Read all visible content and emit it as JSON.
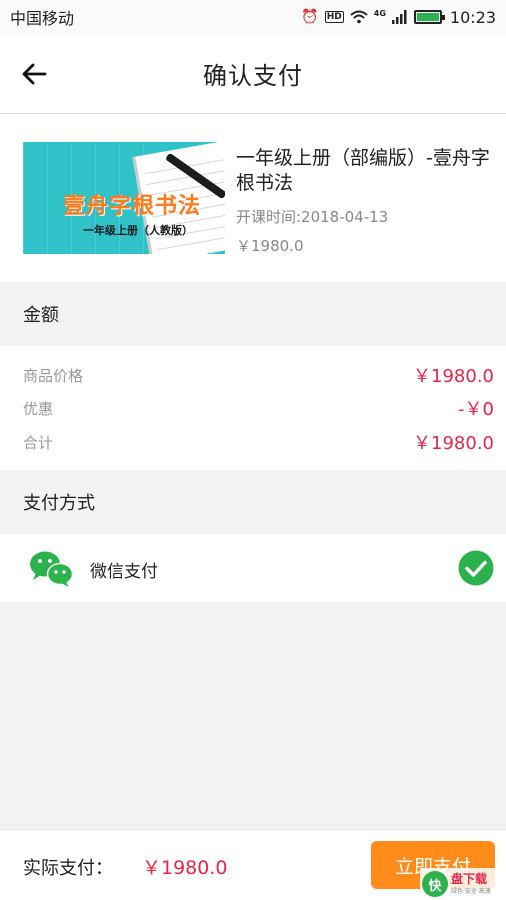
{
  "statusbar": {
    "carrier": "中国移动",
    "time": "10:23",
    "hd_label": "HD",
    "network_label": "4G"
  },
  "header": {
    "title": "确认支付"
  },
  "product": {
    "thumb_title": "壹舟字根书法",
    "thumb_subtitle": "一年级上册（人教版）",
    "title": "一年级上册（部编版）-壹舟字根书法",
    "date": "开课时间:2018-04-13",
    "price": "￥1980.0"
  },
  "amount_section": {
    "heading": "金额",
    "rows": [
      {
        "label": "商品价格",
        "value": "￥1980.0"
      },
      {
        "label": "优惠",
        "value": "-￥0"
      },
      {
        "label": "合计",
        "value": "￥1980.0"
      }
    ]
  },
  "payment_section": {
    "heading": "支付方式",
    "methods": [
      {
        "label": "微信支付",
        "icon": "wechat-icon",
        "selected": true
      }
    ]
  },
  "footer": {
    "actual_label": "实际支付：",
    "actual_value": "￥1980.0",
    "pay_button": "立即支付"
  },
  "watermark": {
    "logo": "快",
    "text": "盘下载",
    "sub": "绿色·安全·高速"
  },
  "colors": {
    "price_red": "#e8264a",
    "button_orange": "#ff8c1a",
    "check_green": "#2bb24c",
    "background": "#f2f2f2"
  }
}
